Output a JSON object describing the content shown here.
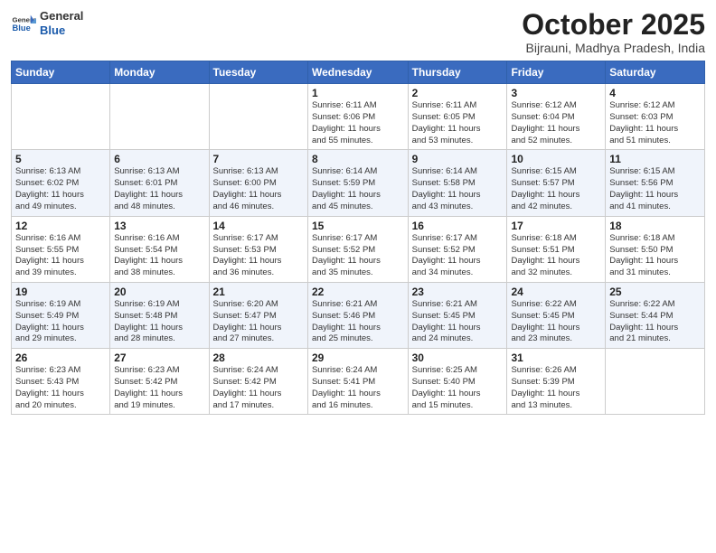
{
  "header": {
    "logo_general": "General",
    "logo_blue": "Blue",
    "month": "October 2025",
    "location": "Bijrauni, Madhya Pradesh, India"
  },
  "weekdays": [
    "Sunday",
    "Monday",
    "Tuesday",
    "Wednesday",
    "Thursday",
    "Friday",
    "Saturday"
  ],
  "weeks": [
    [
      {
        "day": "",
        "info": ""
      },
      {
        "day": "",
        "info": ""
      },
      {
        "day": "",
        "info": ""
      },
      {
        "day": "1",
        "info": "Sunrise: 6:11 AM\nSunset: 6:06 PM\nDaylight: 11 hours\nand 55 minutes."
      },
      {
        "day": "2",
        "info": "Sunrise: 6:11 AM\nSunset: 6:05 PM\nDaylight: 11 hours\nand 53 minutes."
      },
      {
        "day": "3",
        "info": "Sunrise: 6:12 AM\nSunset: 6:04 PM\nDaylight: 11 hours\nand 52 minutes."
      },
      {
        "day": "4",
        "info": "Sunrise: 6:12 AM\nSunset: 6:03 PM\nDaylight: 11 hours\nand 51 minutes."
      }
    ],
    [
      {
        "day": "5",
        "info": "Sunrise: 6:13 AM\nSunset: 6:02 PM\nDaylight: 11 hours\nand 49 minutes."
      },
      {
        "day": "6",
        "info": "Sunrise: 6:13 AM\nSunset: 6:01 PM\nDaylight: 11 hours\nand 48 minutes."
      },
      {
        "day": "7",
        "info": "Sunrise: 6:13 AM\nSunset: 6:00 PM\nDaylight: 11 hours\nand 46 minutes."
      },
      {
        "day": "8",
        "info": "Sunrise: 6:14 AM\nSunset: 5:59 PM\nDaylight: 11 hours\nand 45 minutes."
      },
      {
        "day": "9",
        "info": "Sunrise: 6:14 AM\nSunset: 5:58 PM\nDaylight: 11 hours\nand 43 minutes."
      },
      {
        "day": "10",
        "info": "Sunrise: 6:15 AM\nSunset: 5:57 PM\nDaylight: 11 hours\nand 42 minutes."
      },
      {
        "day": "11",
        "info": "Sunrise: 6:15 AM\nSunset: 5:56 PM\nDaylight: 11 hours\nand 41 minutes."
      }
    ],
    [
      {
        "day": "12",
        "info": "Sunrise: 6:16 AM\nSunset: 5:55 PM\nDaylight: 11 hours\nand 39 minutes."
      },
      {
        "day": "13",
        "info": "Sunrise: 6:16 AM\nSunset: 5:54 PM\nDaylight: 11 hours\nand 38 minutes."
      },
      {
        "day": "14",
        "info": "Sunrise: 6:17 AM\nSunset: 5:53 PM\nDaylight: 11 hours\nand 36 minutes."
      },
      {
        "day": "15",
        "info": "Sunrise: 6:17 AM\nSunset: 5:52 PM\nDaylight: 11 hours\nand 35 minutes."
      },
      {
        "day": "16",
        "info": "Sunrise: 6:17 AM\nSunset: 5:52 PM\nDaylight: 11 hours\nand 34 minutes."
      },
      {
        "day": "17",
        "info": "Sunrise: 6:18 AM\nSunset: 5:51 PM\nDaylight: 11 hours\nand 32 minutes."
      },
      {
        "day": "18",
        "info": "Sunrise: 6:18 AM\nSunset: 5:50 PM\nDaylight: 11 hours\nand 31 minutes."
      }
    ],
    [
      {
        "day": "19",
        "info": "Sunrise: 6:19 AM\nSunset: 5:49 PM\nDaylight: 11 hours\nand 29 minutes."
      },
      {
        "day": "20",
        "info": "Sunrise: 6:19 AM\nSunset: 5:48 PM\nDaylight: 11 hours\nand 28 minutes."
      },
      {
        "day": "21",
        "info": "Sunrise: 6:20 AM\nSunset: 5:47 PM\nDaylight: 11 hours\nand 27 minutes."
      },
      {
        "day": "22",
        "info": "Sunrise: 6:21 AM\nSunset: 5:46 PM\nDaylight: 11 hours\nand 25 minutes."
      },
      {
        "day": "23",
        "info": "Sunrise: 6:21 AM\nSunset: 5:45 PM\nDaylight: 11 hours\nand 24 minutes."
      },
      {
        "day": "24",
        "info": "Sunrise: 6:22 AM\nSunset: 5:45 PM\nDaylight: 11 hours\nand 23 minutes."
      },
      {
        "day": "25",
        "info": "Sunrise: 6:22 AM\nSunset: 5:44 PM\nDaylight: 11 hours\nand 21 minutes."
      }
    ],
    [
      {
        "day": "26",
        "info": "Sunrise: 6:23 AM\nSunset: 5:43 PM\nDaylight: 11 hours\nand 20 minutes."
      },
      {
        "day": "27",
        "info": "Sunrise: 6:23 AM\nSunset: 5:42 PM\nDaylight: 11 hours\nand 19 minutes."
      },
      {
        "day": "28",
        "info": "Sunrise: 6:24 AM\nSunset: 5:42 PM\nDaylight: 11 hours\nand 17 minutes."
      },
      {
        "day": "29",
        "info": "Sunrise: 6:24 AM\nSunset: 5:41 PM\nDaylight: 11 hours\nand 16 minutes."
      },
      {
        "day": "30",
        "info": "Sunrise: 6:25 AM\nSunset: 5:40 PM\nDaylight: 11 hours\nand 15 minutes."
      },
      {
        "day": "31",
        "info": "Sunrise: 6:26 AM\nSunset: 5:39 PM\nDaylight: 11 hours\nand 13 minutes."
      },
      {
        "day": "",
        "info": ""
      }
    ]
  ]
}
